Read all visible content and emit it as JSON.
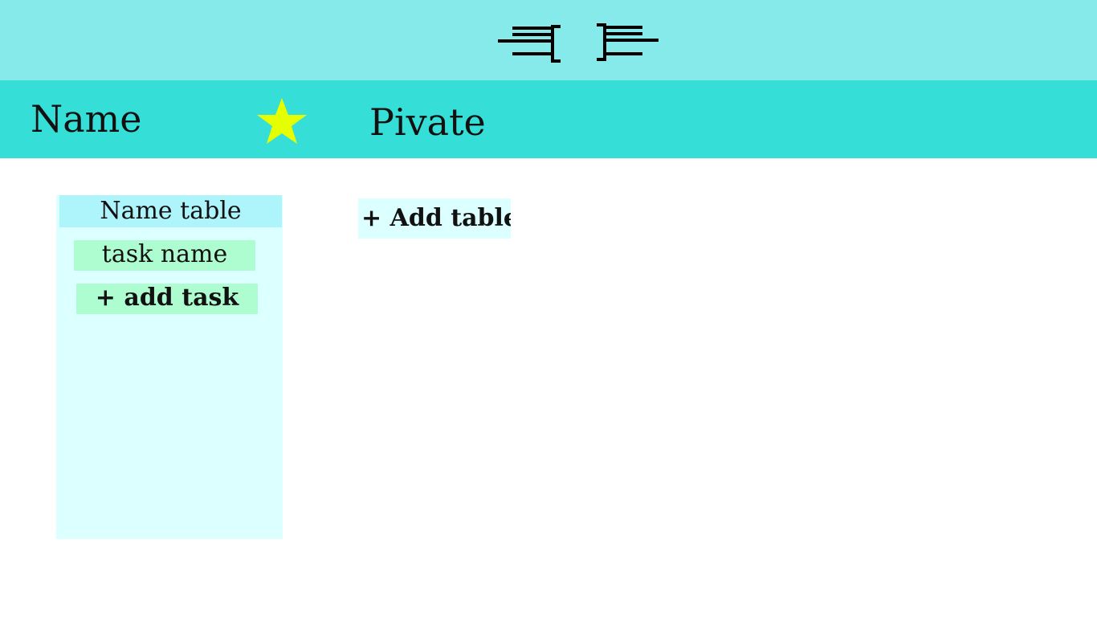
{
  "app": {
    "logo_icon": "brackets-with-speed-lines-icon"
  },
  "board": {
    "name": "Name",
    "star_icon": "star-icon",
    "visibility": "Pivate"
  },
  "lists": [
    {
      "title": "Name table",
      "tasks": [
        {
          "name": "task name"
        }
      ],
      "add_task_label": "+ add task"
    }
  ],
  "add_table_label": "+ Add table",
  "colors": {
    "topbar": "#87eaea",
    "board_header": "#35ded6",
    "list_background": "#dcffff",
    "list_title_background": "#aef4fb",
    "task_background": "#aefdd0",
    "star": "#e6ff00"
  }
}
